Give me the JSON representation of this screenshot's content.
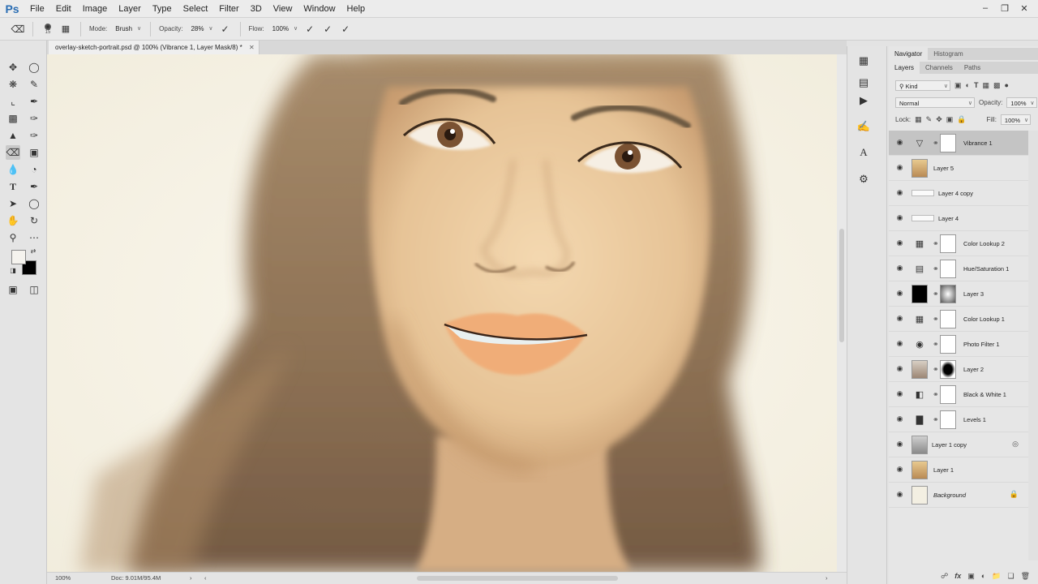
{
  "app": {
    "logo": "Ps"
  },
  "menu": [
    "File",
    "Edit",
    "Image",
    "Layer",
    "Type",
    "Select",
    "Filter",
    "3D",
    "View",
    "Window",
    "Help"
  ],
  "window_controls": {
    "minimize": "–",
    "restore": "❐",
    "close": "✕"
  },
  "options": {
    "brush_size": "15",
    "mode_label": "Mode:",
    "mode_value": "Brush",
    "opacity_label": "Opacity:",
    "opacity_value": "28%",
    "flow_label": "Flow:",
    "flow_value": "100%"
  },
  "document": {
    "tab_title": "overlay-sketch-portrait.psd @ 100% (Vibrance 1, Layer Mask/8) *",
    "close": "✕",
    "zoom": "100%",
    "doc_info": "Doc: 9.01M/95.4M"
  },
  "panels": {
    "top_tabs": [
      "Navigator",
      "Histogram"
    ],
    "layer_tabs": [
      "Layers",
      "Channels",
      "Paths"
    ],
    "filter_kind": "Kind",
    "blend_mode": "Normal",
    "opacity_label": "Opacity:",
    "opacity_value": "100%",
    "lock_label": "Lock:",
    "fill_label": "Fill:",
    "fill_value": "100%"
  },
  "layers": [
    {
      "name": "Vibrance 1",
      "type": "adjustment",
      "icon": "vibrance-icon",
      "glyph": "▽",
      "selected": true
    },
    {
      "name": "Layer 5",
      "type": "pixel",
      "icon": "portrait-thumb"
    },
    {
      "name": "Layer 4 copy",
      "type": "wide"
    },
    {
      "name": "Layer 4",
      "type": "wide"
    },
    {
      "name": "Color Lookup 2",
      "type": "adjustment",
      "icon": "color-lookup-icon",
      "glyph": "▦"
    },
    {
      "name": "Hue/Saturation 1",
      "type": "adjustment",
      "icon": "hue-saturation-icon",
      "glyph": "▤"
    },
    {
      "name": "Layer 3",
      "type": "pixel-mask",
      "icon": "black-thumb"
    },
    {
      "name": "Color Lookup 1",
      "type": "adjustment",
      "icon": "color-lookup-icon",
      "glyph": "▦"
    },
    {
      "name": "Photo Filter 1",
      "type": "adjustment",
      "icon": "photo-filter-icon",
      "glyph": "◉"
    },
    {
      "name": "Layer 2",
      "type": "pixel-mask",
      "icon": "sketch-thumb"
    },
    {
      "name": "Black & White 1",
      "type": "adjustment",
      "icon": "black-white-icon",
      "glyph": "◧"
    },
    {
      "name": "Levels 1",
      "type": "adjustment",
      "icon": "levels-icon",
      "glyph": "▇"
    },
    {
      "name": "Layer 1 copy",
      "type": "smart",
      "icon": "smart-object-thumb"
    },
    {
      "name": "Layer 1",
      "type": "pixel",
      "icon": "portrait-thumb"
    },
    {
      "name": "Background",
      "type": "background",
      "icon": "lock-icon"
    }
  ],
  "colors": {
    "foreground": "#f5f3ee",
    "background": "#000000",
    "accent": "#2a6db3",
    "selection": "#c4c4c4"
  }
}
